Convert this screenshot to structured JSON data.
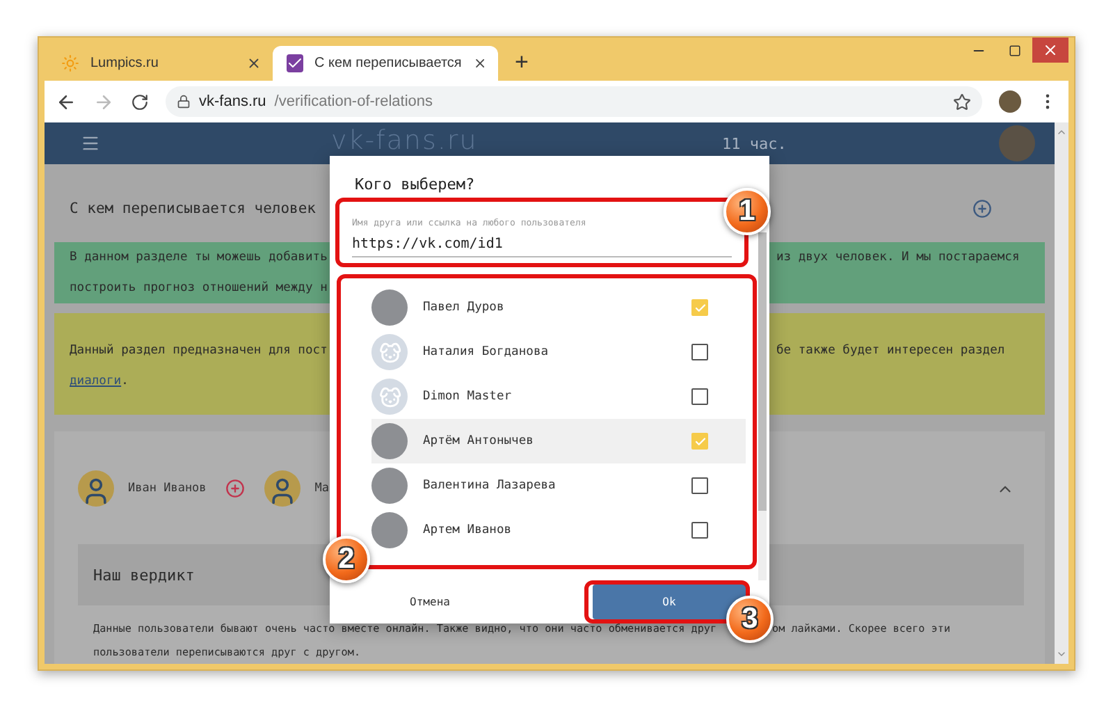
{
  "browser": {
    "tabs": [
      {
        "title": "Lumpics.ru",
        "selected": false
      },
      {
        "title": "С кем переписывается",
        "selected": true
      }
    ],
    "new_tab": "+",
    "domain": "vk-fans.ru",
    "path": "/verification-of-relations",
    "forward_disabled": true
  },
  "site_header": {
    "logo": "vk-fans.ru",
    "time": "11 час."
  },
  "section": {
    "title": "С кем переписывается человек",
    "notices": [
      {
        "kind": "info",
        "lines": [
          {
            "left": "В данном разделе ты можешь добавить",
            "right": "из двух человек. И мы постараемся"
          },
          {
            "left": "построить прогноз отношений между н"
          }
        ]
      },
      {
        "kind": "warning",
        "lines": [
          {
            "left": "Данный раздел предназначен для пост",
            "right": "бе также будет интересен раздел"
          },
          {
            "link": "диалоги",
            "left": "."
          }
        ]
      }
    ]
  },
  "pair": {
    "people": [
      {
        "name": "Иван Иванов"
      },
      {
        "name": "Ма"
      }
    ],
    "expanded": true
  },
  "verdict": {
    "title": "Наш вердикт",
    "lines": [
      {
        "left": "Данные пользователи бывают очень часто вместе онлайн. Также видно, что они часто обменивается друг",
        "right": "ом лайками. Скорее всего эти"
      },
      {
        "left": "пользователи переписываются друг с другом."
      }
    ]
  },
  "dialog": {
    "title": "Кого выберем?",
    "field": {
      "label": "Имя друга или ссылка на любого пользователя",
      "value": "https://vk.com/id1"
    },
    "friends": [
      {
        "name": "Павел Дуров",
        "kind": "photo",
        "checked": true,
        "highlighted": false
      },
      {
        "name": "Наталия Богданова",
        "kind": "default",
        "checked": false,
        "highlighted": false
      },
      {
        "name": "Dimon Master",
        "kind": "default",
        "checked": false,
        "highlighted": false
      },
      {
        "name": "Артём Антонычев",
        "kind": "photo",
        "checked": true,
        "highlighted": true
      },
      {
        "name": "Валентина Лазарева",
        "kind": "photo",
        "checked": false,
        "highlighted": false
      },
      {
        "name": "Артем Иванов",
        "kind": "photo",
        "checked": false,
        "highlighted": false
      }
    ],
    "cancel": "Отмена",
    "ok": "Ok"
  },
  "annotations": [
    "1",
    "2",
    "3"
  ]
}
